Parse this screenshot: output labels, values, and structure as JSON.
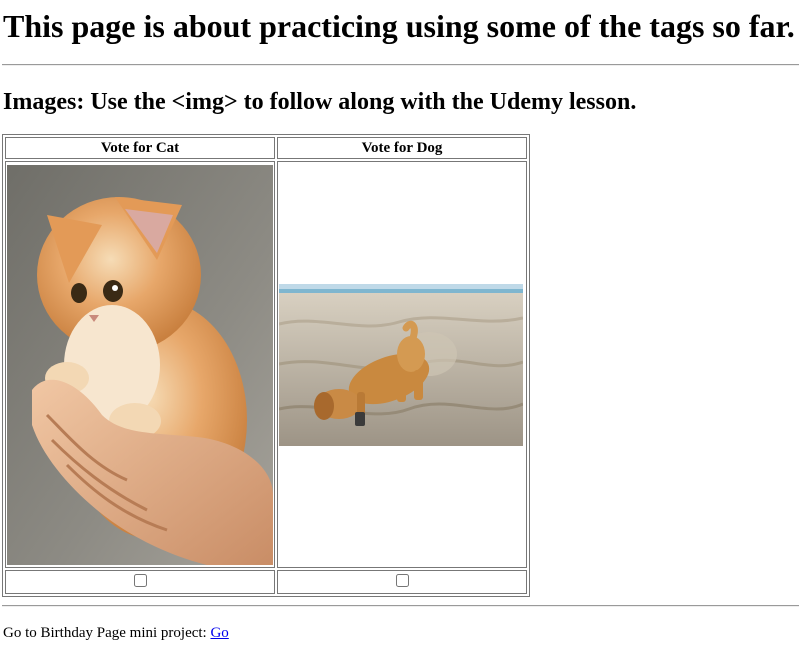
{
  "heading": "This page is about practicing using some of the tags so far.",
  "subheading": "Images: Use the <img> to follow along with the Udemy lesson.",
  "table": {
    "columns": [
      {
        "label": "Vote for Cat",
        "checked": false
      },
      {
        "label": "Vote for Dog",
        "checked": false
      }
    ]
  },
  "footer": {
    "text": "Go to Birthday Page mini project: ",
    "link_label": "Go"
  },
  "colors": {
    "link": "#0000ee",
    "rule": "#9a9a9a"
  }
}
